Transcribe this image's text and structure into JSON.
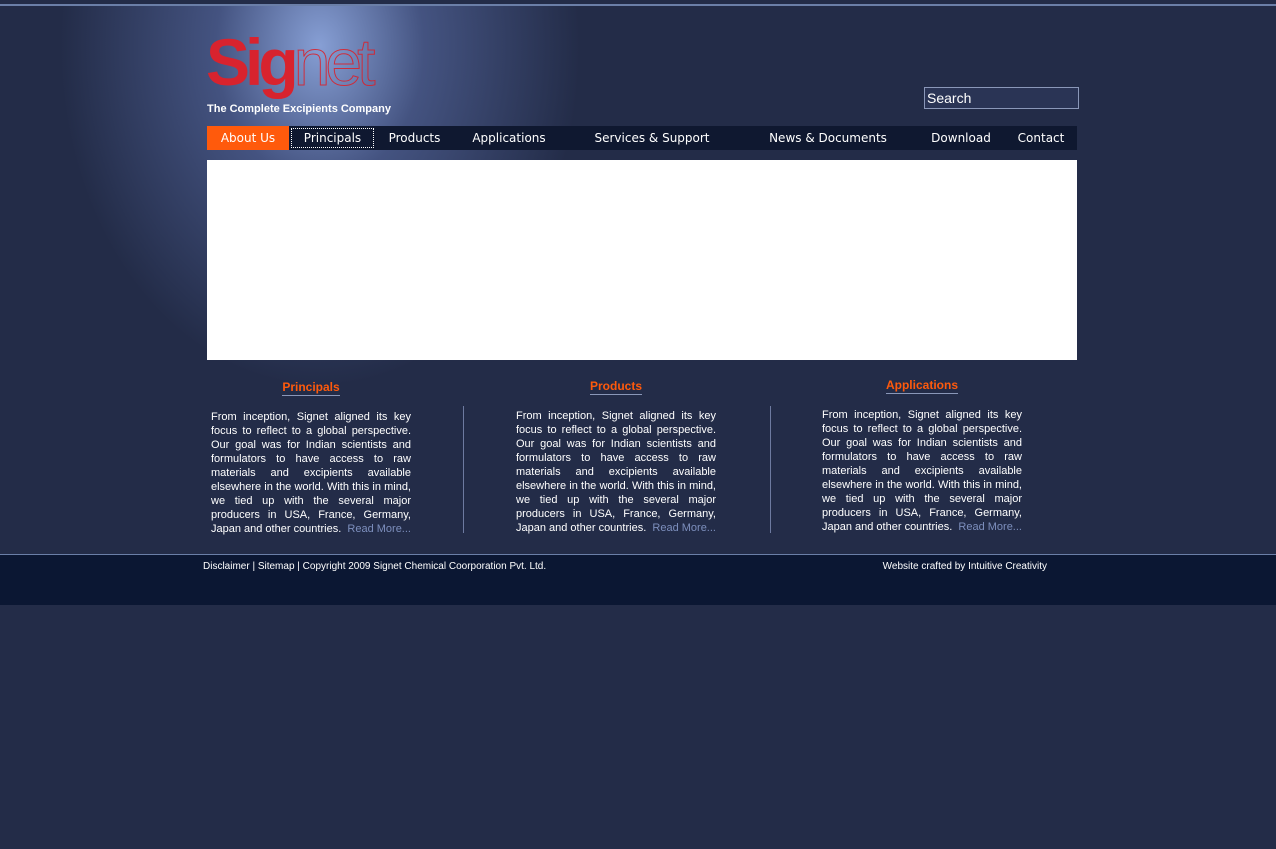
{
  "brand": {
    "logo_part1": "Sig",
    "logo_part2": "net",
    "tagline": "The Complete Excipients Company",
    "accent": "#ff5a0c",
    "logo_color": "#d8232e"
  },
  "search": {
    "placeholder": "Search"
  },
  "nav": [
    {
      "label": "About Us"
    },
    {
      "label": "Principals"
    },
    {
      "label": "Products"
    },
    {
      "label": "Applications"
    },
    {
      "label": "Services & Support"
    },
    {
      "label": "News & Documents"
    },
    {
      "label": "Download"
    },
    {
      "label": "Contact"
    }
  ],
  "columns": [
    {
      "title": "Principals",
      "body": "From inception, Signet aligned its key focus to reflect to a global perspective. Our goal was for Indian scientists and formulators to have access to raw materials and excipients available elsewhere in the world. With this in mind, we tied up with the several major producers in USA, France, Germany, Japan and other countries.",
      "more": "Read More..."
    },
    {
      "title": "Products",
      "body": "From inception, Signet aligned its key focus to reflect to a global perspective. Our goal was for Indian scientists and formulators to have access to raw materials and excipients available elsewhere in the world. With this in mind, we tied up with the several major producers in USA, France, Germany, Japan and other countries.",
      "more": "Read More..."
    },
    {
      "title": "Applications",
      "body": "From inception, Signet aligned its key focus to reflect to a global perspective. Our goal was for Indian scientists and formulators to have access to raw materials and excipients available elsewhere in the world. With this in mind, we tied up with the several major producers in USA, France, Germany, Japan and other countries.",
      "more": "Read More..."
    }
  ],
  "footer": {
    "disclaimer": "Disclaimer",
    "sep": " | ",
    "sitemap": "Sitemap",
    "copyright": "Copyright 2009 Signet Chemical Coorporation Pvt. Ltd.",
    "credit": "Website crafted by Intuitive Creativity"
  }
}
